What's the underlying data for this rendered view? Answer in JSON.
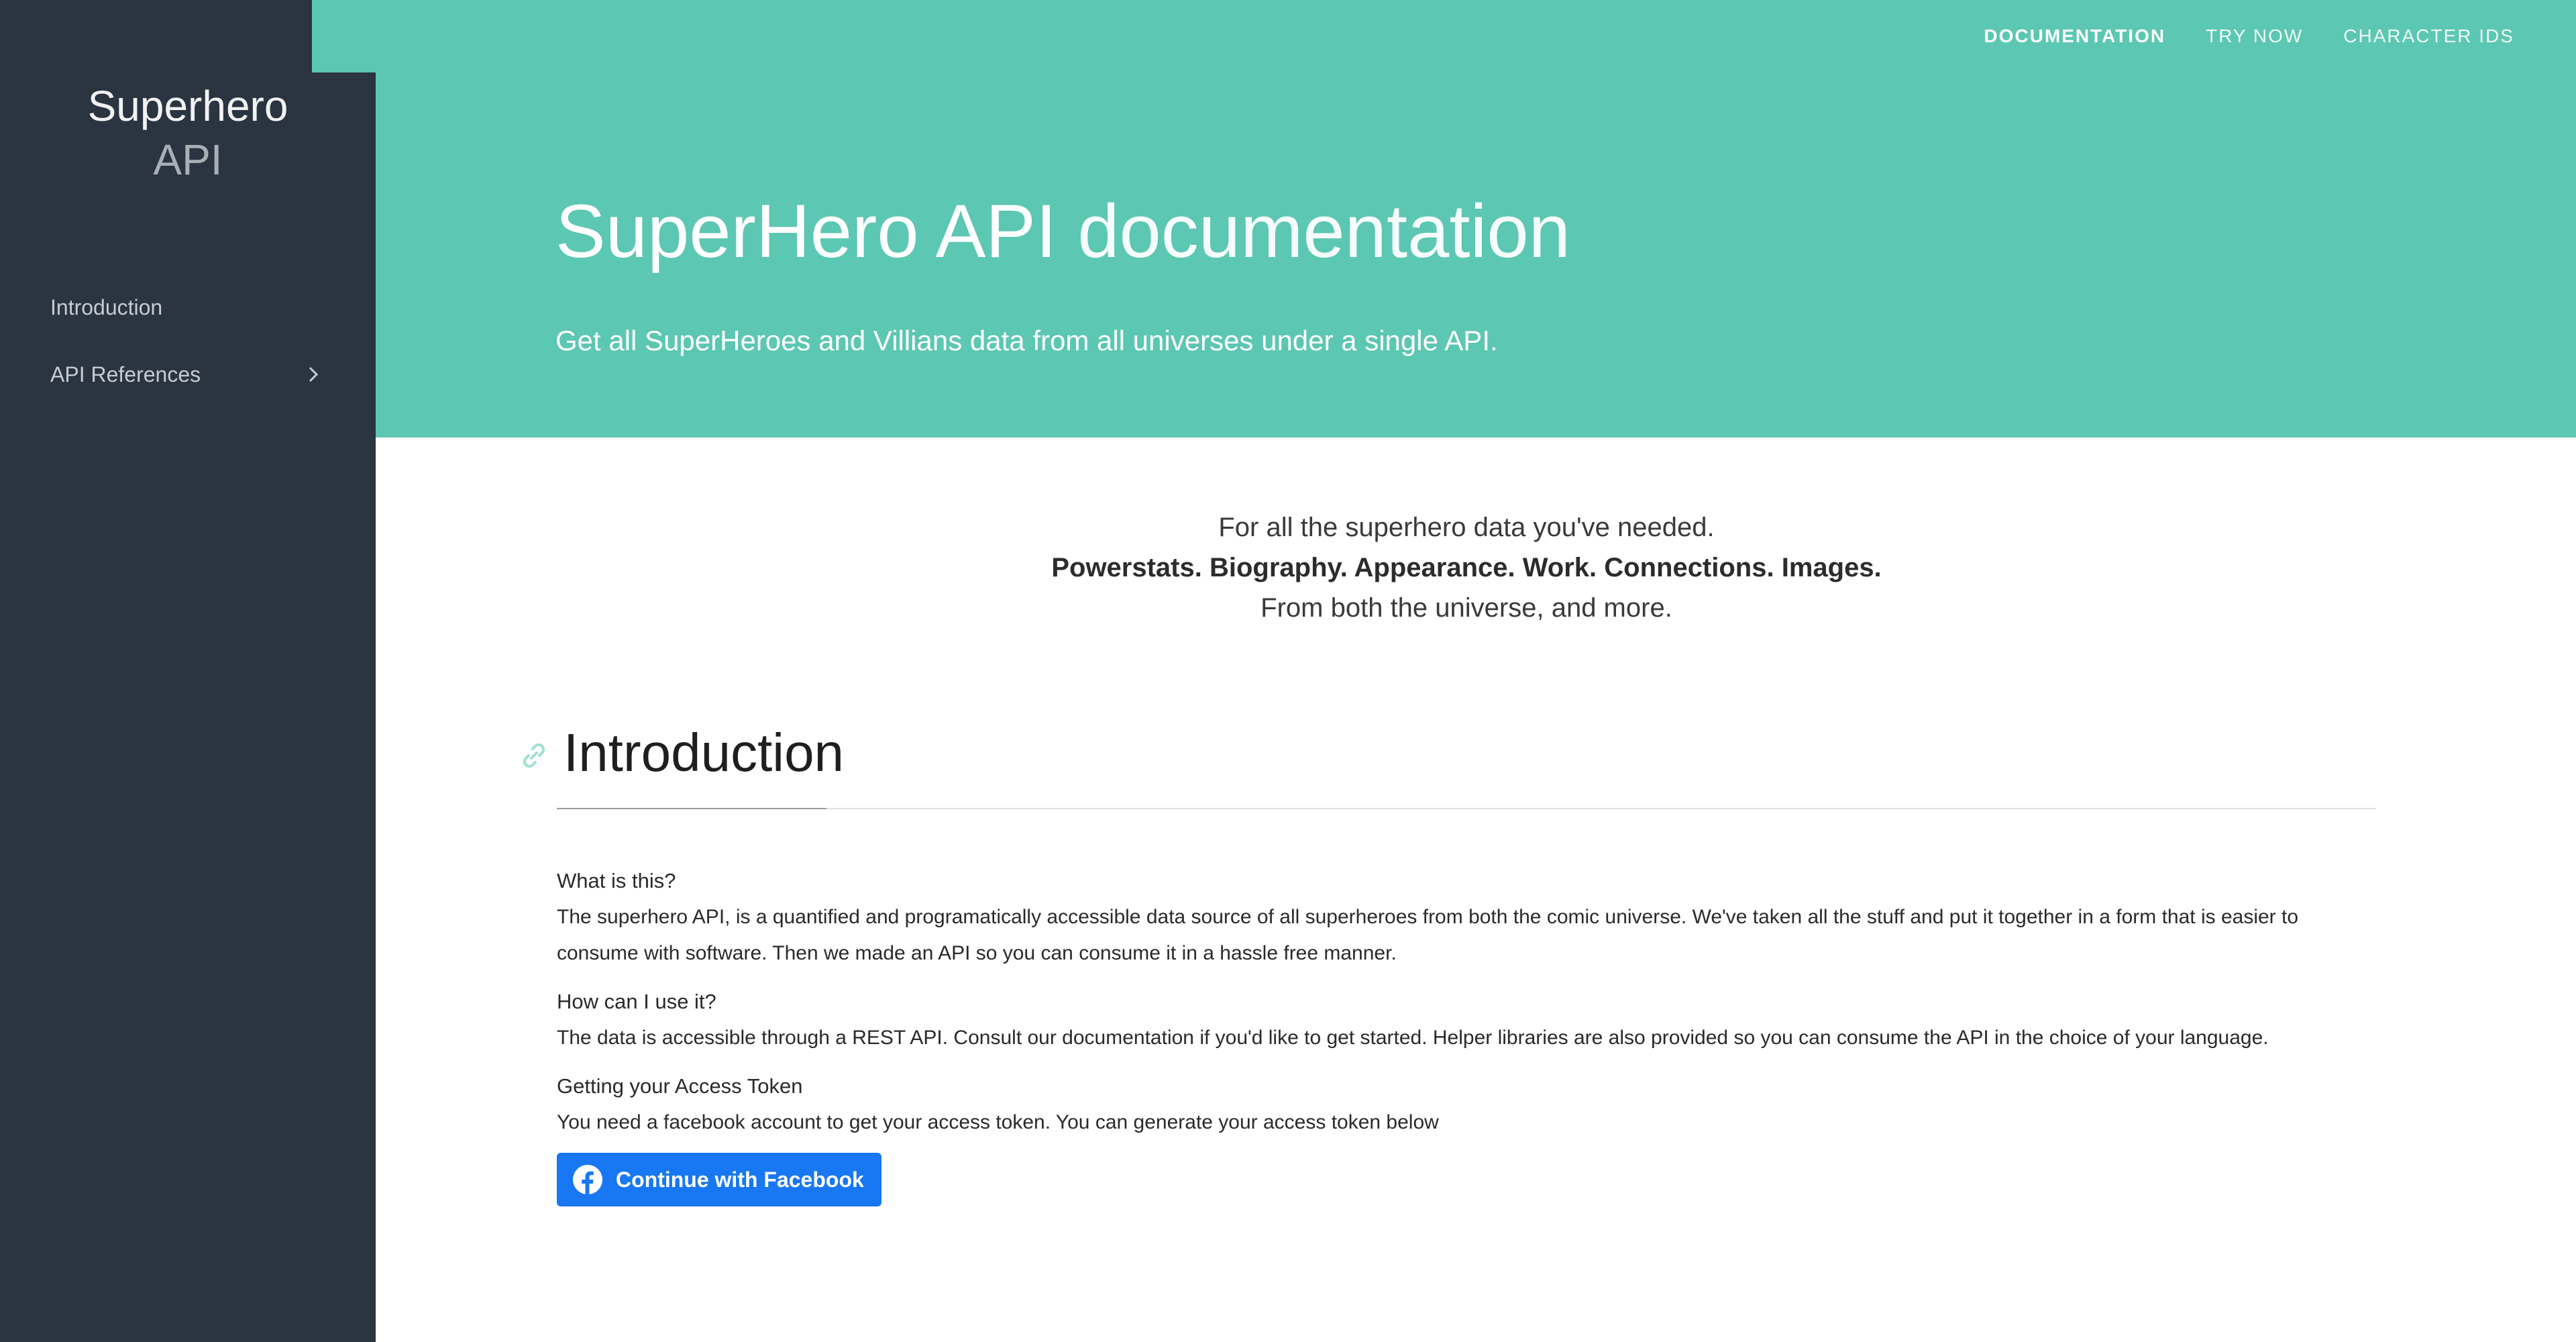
{
  "sidebar": {
    "brand_line1": "Superhero",
    "brand_line2": "API",
    "items": [
      {
        "label": "Introduction"
      },
      {
        "label": "API References"
      }
    ]
  },
  "topnav": {
    "items": [
      {
        "label": "DOCUMENTATION",
        "active": true
      },
      {
        "label": "TRY NOW",
        "active": false
      },
      {
        "label": "CHARACTER IDS",
        "active": false
      }
    ]
  },
  "hero": {
    "title_main": "SuperHero API",
    "title_light": "documentation",
    "subtitle": "Get all SuperHeroes and Villians data from all universes under a single API."
  },
  "tagline": {
    "line1": "For all the superhero data you've needed.",
    "line2": "Powerstats. Biography. Appearance. Work. Connections. Images.",
    "line3": "From both the universe, and more."
  },
  "intro": {
    "heading": "Introduction",
    "q1": "What is this?",
    "a1": "The superhero API, is a quantified and programatically accessible data source of all superheroes from both the comic universe. We've taken all the stuff and put it together in a form that is easier to consume with software. Then we made an API so you can consume it in a hassle free manner.",
    "q2": "How can I use it?",
    "a2": "The data is accessible through a REST API. Consult our documentation if you'd like to get started. Helper libraries are also provided so you can consume the API in the choice of your language.",
    "q3": "Getting your Access Token",
    "a3": "You need a facebook account to get your access token. You can generate your access token below",
    "fb_button": "Continue with Facebook"
  },
  "colors": {
    "sidebar_bg": "#2a3541",
    "accent": "#5cc7b2",
    "facebook": "#1877f2"
  },
  "icons": {
    "chevron": "chevron-right-icon",
    "link": "link-icon",
    "facebook": "facebook-icon"
  }
}
